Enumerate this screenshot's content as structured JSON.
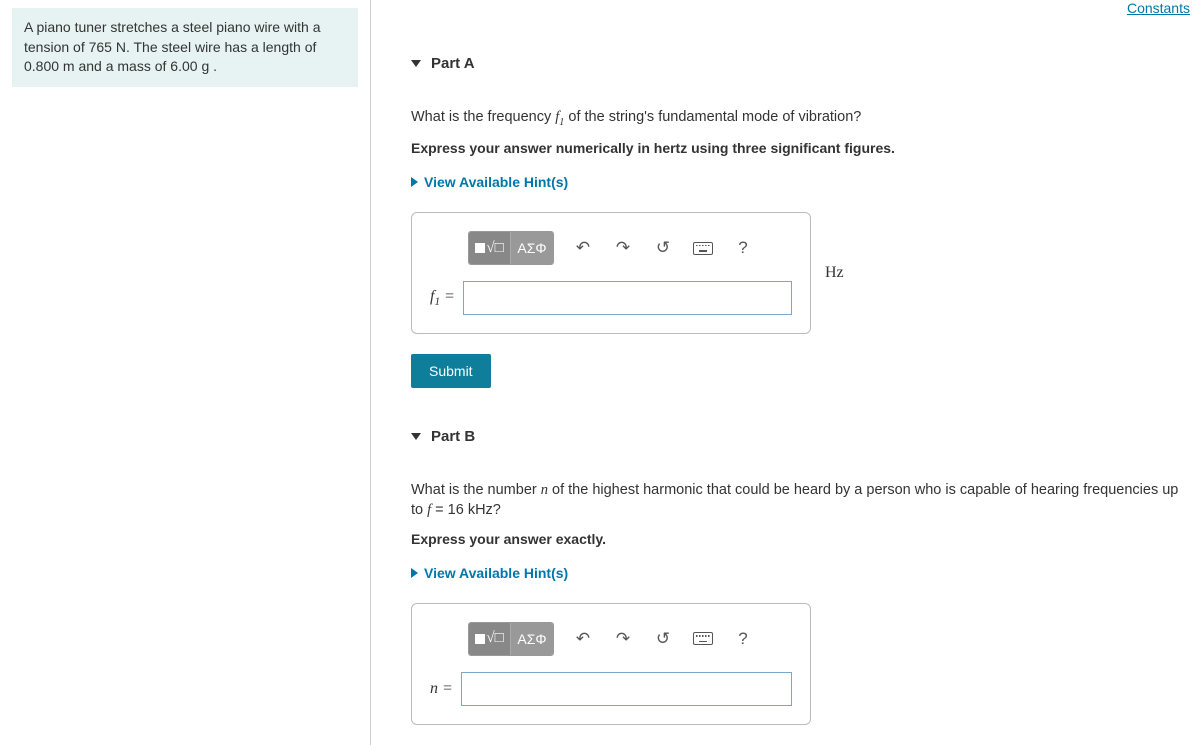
{
  "header": {
    "constants_link": "Constants"
  },
  "problem": {
    "text": "A piano tuner stretches a steel piano wire with a tension of 765 N. The steel wire has a length of 0.800 m and a mass of 6.00 g ."
  },
  "partA": {
    "title": "Part A",
    "question_prefix": "What is the frequency ",
    "question_var": "f",
    "question_sub": "1",
    "question_suffix": " of the string's fundamental mode of vibration?",
    "instruction": "Express your answer numerically in hertz using three significant figures.",
    "hints_label": "View Available Hint(s)",
    "toolbar": {
      "templates": "",
      "greek": "ΑΣΦ",
      "help": "?"
    },
    "var_label_html": "f₁ =",
    "var_base": "f",
    "var_sub": "1",
    "equals": " = ",
    "unit": "Hz",
    "submit": "Submit",
    "value": ""
  },
  "partB": {
    "title": "Part B",
    "question_prefix": "What is the number ",
    "question_var": "n",
    "question_mid": " of the highest harmonic that could be heard by a person who is capable of hearing frequencies up to ",
    "question_f": "f",
    "question_eq": " = 16 kHz?",
    "instruction": "Express your answer exactly.",
    "hints_label": "View Available Hint(s)",
    "toolbar": {
      "greek": "ΑΣΦ",
      "help": "?"
    },
    "var_base": "n",
    "equals": " = ",
    "value": ""
  }
}
